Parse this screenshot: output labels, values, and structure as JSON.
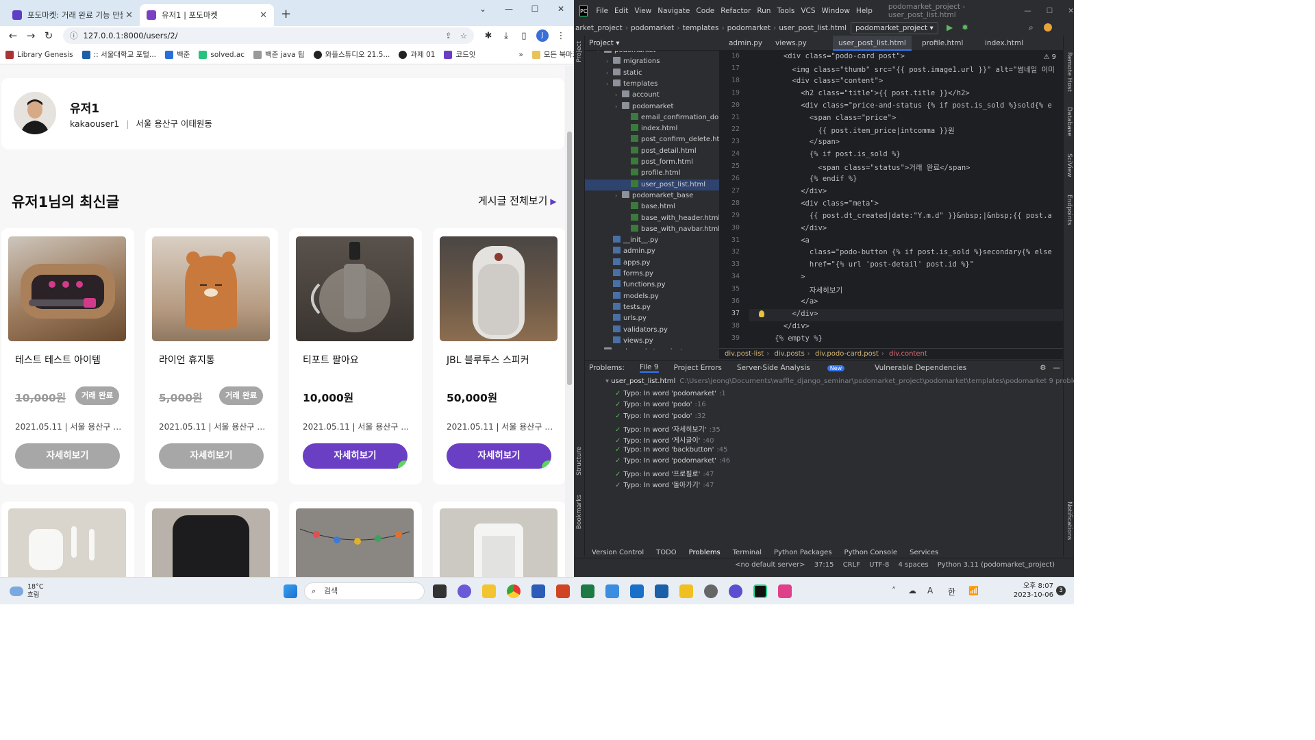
{
  "browser": {
    "tabs": [
      {
        "title": "포도마켓: 거래 완료 기능 만들기",
        "favicon_color": "#5f3dc4"
      },
      {
        "title": "유저1 | 포도마켓",
        "favicon_color": "#7b3fc4"
      }
    ],
    "url": "127.0.0.1:8000/users/2/",
    "profile_initial": "J",
    "bookmarks": [
      "Library Genesis",
      ":: 서울대학교 포털...",
      "백준",
      "solved.ac",
      "백준 java 팁",
      "와플스튜디오 21.5...",
      "과제 01",
      "코드잇"
    ],
    "bookmarks_overflow": "»",
    "all_bookmarks": "모든 북마크"
  },
  "profile": {
    "name": "유저1",
    "username": "kakaouser1",
    "location": "서울 용산구 이태원동"
  },
  "section": {
    "title": "유저1님의 최신글",
    "see_all": "게시글 전체보기"
  },
  "posts": [
    {
      "title": "테스트 테스트 아이템",
      "price": "10,000원",
      "is_sold": true,
      "status": "거래 완료",
      "meta": "2021.05.11 | 서울 용산구 …",
      "button": "자세히보기",
      "img_color": "#8a6a4a"
    },
    {
      "title": "라이언 휴지통",
      "price": "5,000원",
      "is_sold": true,
      "status": "거래 완료",
      "meta": "2021.05.11 | 서울 용산구 …",
      "button": "자세히보기",
      "img_color": "#b89470"
    },
    {
      "title": "티포트 팔아요",
      "price": "10,000원",
      "is_sold": false,
      "status": "",
      "meta": "2021.05.11 | 서울 용산구 …",
      "button": "자세히보기",
      "img_color": "#4a423c"
    },
    {
      "title": "JBL 블루투스 스피커",
      "price": "50,000원",
      "is_sold": false,
      "status": "",
      "meta": "2021.05.11 | 서울 용산구 …",
      "button": "자세히보기",
      "img_color": "#8c7054"
    }
  ],
  "posts_row2_colors": [
    "#d9d4cc",
    "#b8b2aa",
    "#8a8682",
    "#ccc8c2"
  ],
  "ide": {
    "menu": [
      "File",
      "Edit",
      "View",
      "Navigate",
      "Code",
      "Refactor",
      "Run",
      "Tools",
      "VCS",
      "Window",
      "Help"
    ],
    "title": "podomarket_project - user_post_list.html",
    "nav_path": [
      "arket_project",
      "podomarket",
      "templates",
      "podomarket",
      "user_post_list.html"
    ],
    "run_config": "podomarket_project",
    "project_label": "Project",
    "editor_tabs": [
      "admin.py",
      "views.py",
      "user_post_list.html",
      "profile.html",
      "index.html"
    ],
    "tree": [
      {
        "label": "podomarket",
        "type": "folder",
        "depth": 2
      },
      {
        "label": "migrations",
        "type": "folder",
        "depth": 3
      },
      {
        "label": "static",
        "type": "folder",
        "depth": 3
      },
      {
        "label": "templates",
        "type": "folder",
        "depth": 3
      },
      {
        "label": "account",
        "type": "folder",
        "depth": 4
      },
      {
        "label": "podomarket",
        "type": "folder",
        "depth": 4
      },
      {
        "label": "email_confirmation_do",
        "type": "html",
        "depth": 5
      },
      {
        "label": "index.html",
        "type": "html",
        "depth": 5
      },
      {
        "label": "post_confirm_delete.ht",
        "type": "html",
        "depth": 5
      },
      {
        "label": "post_detail.html",
        "type": "html",
        "depth": 5
      },
      {
        "label": "post_form.html",
        "type": "html",
        "depth": 5
      },
      {
        "label": "profile.html",
        "type": "html",
        "depth": 5
      },
      {
        "label": "user_post_list.html",
        "type": "html",
        "depth": 5,
        "selected": true
      },
      {
        "label": "podomarket_base",
        "type": "folder",
        "depth": 4
      },
      {
        "label": "base.html",
        "type": "html",
        "depth": 5
      },
      {
        "label": "base_with_header.html",
        "type": "html",
        "depth": 5
      },
      {
        "label": "base_with_navbar.html",
        "type": "html",
        "depth": 5
      },
      {
        "label": "__init__.py",
        "type": "py",
        "depth": 3
      },
      {
        "label": "admin.py",
        "type": "py",
        "depth": 3
      },
      {
        "label": "apps.py",
        "type": "py",
        "depth": 3
      },
      {
        "label": "forms.py",
        "type": "py",
        "depth": 3
      },
      {
        "label": "functions.py",
        "type": "py",
        "depth": 3
      },
      {
        "label": "models.py",
        "type": "py",
        "depth": 3
      },
      {
        "label": "tests.py",
        "type": "py",
        "depth": 3
      },
      {
        "label": "urls.py",
        "type": "py",
        "depth": 3
      },
      {
        "label": "validators.py",
        "type": "py",
        "depth": 3
      },
      {
        "label": "views.py",
        "type": "py",
        "depth": 3
      },
      {
        "label": "podomarket_project",
        "type": "folder",
        "depth": 2
      }
    ],
    "line_numbers": [
      "16",
      "17",
      "18",
      "19",
      "20",
      "21",
      "22",
      "23",
      "24",
      "25",
      "26",
      "27",
      "28",
      "29",
      "30",
      "31",
      "32",
      "33",
      "34",
      "35",
      "36",
      "37",
      "38",
      "39"
    ],
    "current_line": "37",
    "code_lines": [
      "      <div class=\"podo-card post\">",
      "        <img class=\"thumb\" src=\"{{ post.image1.url }}\" alt=\"썸네일 이미",
      "        <div class=\"content\">",
      "          <h2 class=\"title\">{{ post.title }}</h2>",
      "          <div class=\"price-and-status {% if post.is_sold %}sold{% e",
      "            <span class=\"price\">",
      "              {{ post.item_price|intcomma }}원",
      "            </span>",
      "            {% if post.is_sold %}",
      "              <span class=\"status\">거래 완료</span>",
      "            {% endif %}",
      "          </div>",
      "          <div class=\"meta\">",
      "            {{ post.dt_created|date:\"Y.m.d\" }}&nbsp;|&nbsp;{{ post.a",
      "          </div>",
      "          <a",
      "            class=\"podo-button {% if post.is_sold %}secondary{% else",
      "            href=\"{% url 'post-detail' post.id %}\"",
      "          >",
      "            자세히보기",
      "          </a>",
      "        </div>",
      "      </div>",
      "    {% empty %}"
    ],
    "warnings_count": "9",
    "breadcrumbs": [
      "div.post-list",
      "div.posts",
      "div.podo-card.post",
      "div.content"
    ],
    "problems": {
      "label": "Problems:",
      "tabs": [
        "File 9",
        "Project Errors",
        "Server-Side Analysis",
        "Vulnerable Dependencies"
      ],
      "new_badge": "New",
      "file": "user_post_list.html",
      "path": "C:\\Users\\jeong\\Documents\\waffle_django_seminar\\podomarket_project\\podomarket\\templates\\podomarket  9 problems",
      "items": [
        {
          "text": "Typo: In word 'podomarket'",
          "line": ":1"
        },
        {
          "text": "Typo: In word 'podo'",
          "line": ":16"
        },
        {
          "text": "Typo: In word 'podo'",
          "line": ":32"
        },
        {
          "text": "Typo: In word '자세히보기'",
          "line": ":35"
        },
        {
          "text": "Typo: In word '게시글이'",
          "line": ":40"
        },
        {
          "text": "Typo: In word 'backbutton'",
          "line": ":45"
        },
        {
          "text": "Typo: In word 'podomarket'",
          "line": ":46"
        },
        {
          "text": "Typo: In word '프로필로'",
          "line": ":47"
        },
        {
          "text": "Typo: In word '돌아가기'",
          "line": ":47"
        }
      ]
    },
    "bottom_tabs": [
      "Version Control",
      "TODO",
      "Problems",
      "Terminal",
      "Python Packages",
      "Python Console",
      "Services"
    ],
    "status": [
      "<no default server>",
      "37:15",
      "CRLF",
      "UTF-8",
      "4 spaces",
      "Python 3.11 (podomarket_project)"
    ],
    "left_labels": [
      "Project",
      "Structure",
      "Bookmarks"
    ],
    "right_labels": [
      "Remote Host",
      "Database",
      "SciView",
      "Endpoints",
      "Notifications"
    ]
  },
  "taskbar": {
    "temp": "18°C",
    "weather": "흐림",
    "search": "검색",
    "ime": "한",
    "ime_mode": "A",
    "time": "오후 8:07",
    "date": "2023-10-06",
    "notif": "3"
  }
}
